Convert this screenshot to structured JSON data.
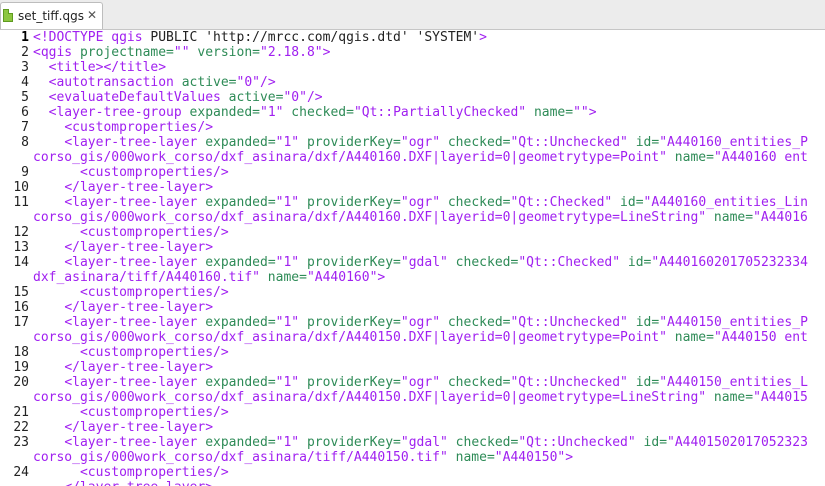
{
  "tab": {
    "filename": "set_tiff.qgs",
    "close_glyph": "✕",
    "icon": "xml-file-icon"
  },
  "colors": {
    "tag": "#a020f0",
    "attr": "#2e8b57",
    "string": "#a020f0",
    "text": "#222222"
  },
  "lines": [
    {
      "n": "1",
      "tokens": [
        [
          "tag",
          "<!DOCTYPE qgis "
        ],
        [
          "plain",
          "PUBLIC 'http://mrcc.com/qgis.dtd' 'SYSTEM'"
        ],
        [
          "tag",
          ">"
        ]
      ]
    },
    {
      "n": "2",
      "tokens": [
        [
          "tag",
          "<qgis "
        ],
        [
          "attr",
          "projectname="
        ],
        [
          "str",
          "\"\""
        ],
        [
          "attr",
          " version="
        ],
        [
          "str",
          "\"2.18.8\""
        ],
        [
          "tag",
          ">"
        ]
      ]
    },
    {
      "n": "3",
      "tokens": [
        [
          "plain",
          "  "
        ],
        [
          "tag",
          "<title></title>"
        ]
      ]
    },
    {
      "n": "4",
      "tokens": [
        [
          "plain",
          "  "
        ],
        [
          "tag",
          "<autotransaction "
        ],
        [
          "attr",
          "active="
        ],
        [
          "str",
          "\"0\""
        ],
        [
          "tag",
          "/>"
        ]
      ]
    },
    {
      "n": "5",
      "tokens": [
        [
          "plain",
          "  "
        ],
        [
          "tag",
          "<evaluateDefaultValues "
        ],
        [
          "attr",
          "active="
        ],
        [
          "str",
          "\"0\""
        ],
        [
          "tag",
          "/>"
        ]
      ]
    },
    {
      "n": "6",
      "tokens": [
        [
          "plain",
          "  "
        ],
        [
          "tag",
          "<layer-tree-group "
        ],
        [
          "attr",
          "expanded="
        ],
        [
          "str",
          "\"1\""
        ],
        [
          "attr",
          " checked="
        ],
        [
          "str",
          "\"Qt::PartiallyChecked\""
        ],
        [
          "attr",
          " name="
        ],
        [
          "str",
          "\"\""
        ],
        [
          "tag",
          ">"
        ]
      ]
    },
    {
      "n": "7",
      "tokens": [
        [
          "plain",
          "    "
        ],
        [
          "tag",
          "<customproperties/>"
        ]
      ]
    },
    {
      "n": "8",
      "tokens": [
        [
          "plain",
          "    "
        ],
        [
          "tag",
          "<layer-tree-layer "
        ],
        [
          "attr",
          "expanded="
        ],
        [
          "str",
          "\"1\""
        ],
        [
          "attr",
          " providerKey="
        ],
        [
          "str",
          "\"ogr\""
        ],
        [
          "attr",
          " checked="
        ],
        [
          "str",
          "\"Qt::Unchecked\""
        ],
        [
          "attr",
          " id="
        ],
        [
          "str",
          "\"A440160_entities_P"
        ]
      ]
    },
    {
      "n": "",
      "tokens": [
        [
          "str",
          "corso_gis/000work_corso/dxf_asinara/dxf/A440160.DXF|layerid=0|geometrytype=Point\""
        ],
        [
          "attr",
          " name="
        ],
        [
          "str",
          "\"A440160 ent"
        ]
      ]
    },
    {
      "n": "9",
      "tokens": [
        [
          "plain",
          "      "
        ],
        [
          "tag",
          "<customproperties/>"
        ]
      ]
    },
    {
      "n": "10",
      "tokens": [
        [
          "plain",
          "    "
        ],
        [
          "tag",
          "</layer-tree-layer>"
        ]
      ]
    },
    {
      "n": "11",
      "tokens": [
        [
          "plain",
          "    "
        ],
        [
          "tag",
          "<layer-tree-layer "
        ],
        [
          "attr",
          "expanded="
        ],
        [
          "str",
          "\"1\""
        ],
        [
          "attr",
          " providerKey="
        ],
        [
          "str",
          "\"ogr\""
        ],
        [
          "attr",
          " checked="
        ],
        [
          "str",
          "\"Qt::Checked\""
        ],
        [
          "attr",
          " id="
        ],
        [
          "str",
          "\"A440160_entities_Lin"
        ]
      ]
    },
    {
      "n": "",
      "tokens": [
        [
          "str",
          "corso_gis/000work_corso/dxf_asinara/dxf/A440160.DXF|layerid=0|geometrytype=LineString\""
        ],
        [
          "attr",
          " name="
        ],
        [
          "str",
          "\"A44016"
        ]
      ]
    },
    {
      "n": "12",
      "tokens": [
        [
          "plain",
          "      "
        ],
        [
          "tag",
          "<customproperties/>"
        ]
      ]
    },
    {
      "n": "13",
      "tokens": [
        [
          "plain",
          "    "
        ],
        [
          "tag",
          "</layer-tree-layer>"
        ]
      ]
    },
    {
      "n": "14",
      "tokens": [
        [
          "plain",
          "    "
        ],
        [
          "tag",
          "<layer-tree-layer "
        ],
        [
          "attr",
          "expanded="
        ],
        [
          "str",
          "\"1\""
        ],
        [
          "attr",
          " providerKey="
        ],
        [
          "str",
          "\"gdal\""
        ],
        [
          "attr",
          " checked="
        ],
        [
          "str",
          "\"Qt::Checked\""
        ],
        [
          "attr",
          " id="
        ],
        [
          "str",
          "\"A440160201705232334"
        ]
      ]
    },
    {
      "n": "",
      "tokens": [
        [
          "str",
          "dxf_asinara/tiff/A440160.tif\""
        ],
        [
          "attr",
          " name="
        ],
        [
          "str",
          "\"A440160\""
        ],
        [
          "tag",
          ">"
        ]
      ]
    },
    {
      "n": "15",
      "tokens": [
        [
          "plain",
          "      "
        ],
        [
          "tag",
          "<customproperties/>"
        ]
      ]
    },
    {
      "n": "16",
      "tokens": [
        [
          "plain",
          "    "
        ],
        [
          "tag",
          "</layer-tree-layer>"
        ]
      ]
    },
    {
      "n": "17",
      "tokens": [
        [
          "plain",
          "    "
        ],
        [
          "tag",
          "<layer-tree-layer "
        ],
        [
          "attr",
          "expanded="
        ],
        [
          "str",
          "\"1\""
        ],
        [
          "attr",
          " providerKey="
        ],
        [
          "str",
          "\"ogr\""
        ],
        [
          "attr",
          " checked="
        ],
        [
          "str",
          "\"Qt::Unchecked\""
        ],
        [
          "attr",
          " id="
        ],
        [
          "str",
          "\"A440150_entities_P"
        ]
      ]
    },
    {
      "n": "",
      "tokens": [
        [
          "str",
          "corso_gis/000work_corso/dxf_asinara/dxf/A440150.DXF|layerid=0|geometrytype=Point\""
        ],
        [
          "attr",
          " name="
        ],
        [
          "str",
          "\"A440150 ent"
        ]
      ]
    },
    {
      "n": "18",
      "tokens": [
        [
          "plain",
          "      "
        ],
        [
          "tag",
          "<customproperties/>"
        ]
      ]
    },
    {
      "n": "19",
      "tokens": [
        [
          "plain",
          "    "
        ],
        [
          "tag",
          "</layer-tree-layer>"
        ]
      ]
    },
    {
      "n": "20",
      "tokens": [
        [
          "plain",
          "    "
        ],
        [
          "tag",
          "<layer-tree-layer "
        ],
        [
          "attr",
          "expanded="
        ],
        [
          "str",
          "\"1\""
        ],
        [
          "attr",
          " providerKey="
        ],
        [
          "str",
          "\"ogr\""
        ],
        [
          "attr",
          " checked="
        ],
        [
          "str",
          "\"Qt::Unchecked\""
        ],
        [
          "attr",
          " id="
        ],
        [
          "str",
          "\"A440150_entities_L"
        ]
      ]
    },
    {
      "n": "",
      "tokens": [
        [
          "str",
          "corso_gis/000work_corso/dxf_asinara/dxf/A440150.DXF|layerid=0|geometrytype=LineString\""
        ],
        [
          "attr",
          " name="
        ],
        [
          "str",
          "\"A44015"
        ]
      ]
    },
    {
      "n": "21",
      "tokens": [
        [
          "plain",
          "      "
        ],
        [
          "tag",
          "<customproperties/>"
        ]
      ]
    },
    {
      "n": "22",
      "tokens": [
        [
          "plain",
          "    "
        ],
        [
          "tag",
          "</layer-tree-layer>"
        ]
      ]
    },
    {
      "n": "23",
      "tokens": [
        [
          "plain",
          "    "
        ],
        [
          "tag",
          "<layer-tree-layer "
        ],
        [
          "attr",
          "expanded="
        ],
        [
          "str",
          "\"1\""
        ],
        [
          "attr",
          " providerKey="
        ],
        [
          "str",
          "\"gdal\""
        ],
        [
          "attr",
          " checked="
        ],
        [
          "str",
          "\"Qt::Unchecked\""
        ],
        [
          "attr",
          " id="
        ],
        [
          "str",
          "\"A4401502017052323"
        ]
      ]
    },
    {
      "n": "",
      "tokens": [
        [
          "str",
          "corso_gis/000work_corso/dxf_asinara/tiff/A440150.tif\""
        ],
        [
          "attr",
          " name="
        ],
        [
          "str",
          "\"A440150\""
        ],
        [
          "tag",
          ">"
        ]
      ]
    },
    {
      "n": "24",
      "tokens": [
        [
          "plain",
          "      "
        ],
        [
          "tag",
          "<customproperties/>"
        ]
      ]
    },
    {
      "n": "",
      "tokens": [
        [
          "plain",
          "    "
        ],
        [
          "tag",
          "</layer-tree-layer>"
        ]
      ]
    }
  ]
}
